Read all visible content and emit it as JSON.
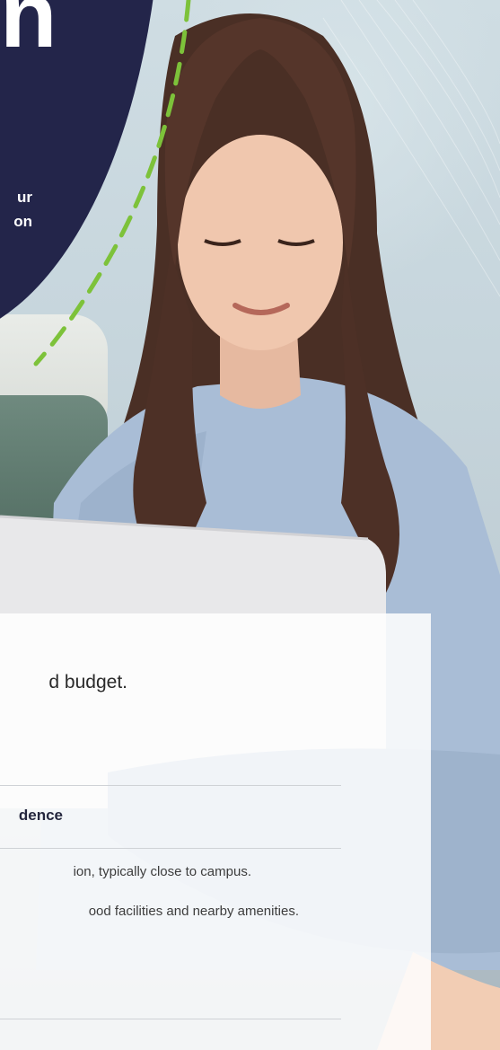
{
  "hero": {
    "headline": "n",
    "sub_lines": [
      "ur",
      "on"
    ]
  },
  "card": {
    "subheading": "d budget.",
    "row_title": "dence",
    "descriptions": [
      "ion, typically close to campus.",
      "ood facilities and nearby amenities."
    ]
  },
  "colors": {
    "navy": "#23254a",
    "accent_green": "#7dc23a"
  }
}
